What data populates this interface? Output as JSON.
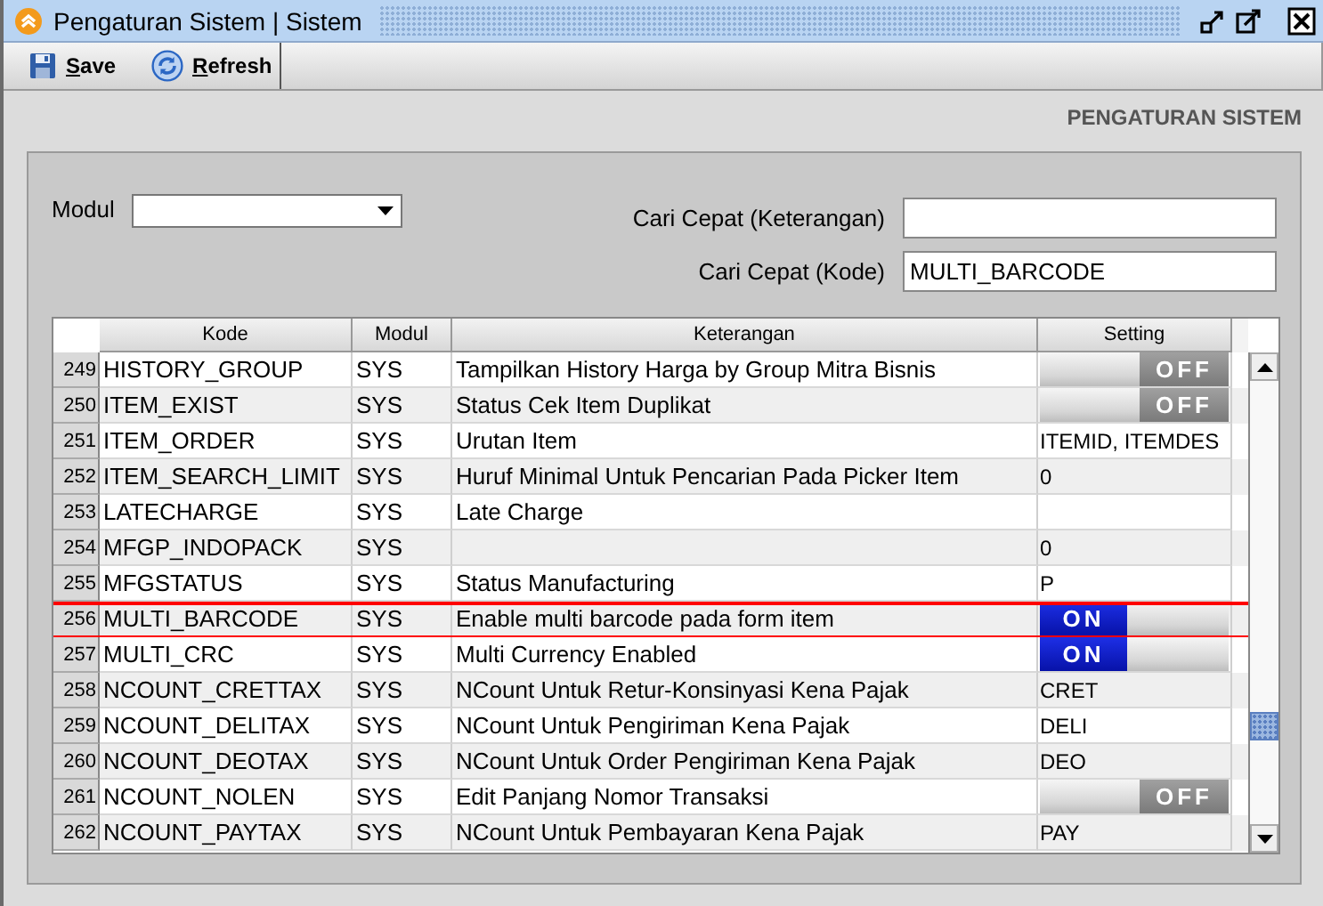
{
  "window": {
    "title": "Pengaturan Sistem | Sistem"
  },
  "toolbar": [
    {
      "label": "Save",
      "kind": "save"
    },
    {
      "label": "Refresh",
      "kind": "refresh"
    }
  ],
  "section_title": "PENGATURAN SISTEM",
  "filters": {
    "modul": {
      "label": "Modul"
    },
    "search_description": {
      "label": "Cari Cepat (Keterangan)"
    },
    "search_code": {
      "label": "Cari Cepat (Kode)",
      "value": "MULTI_BARCODE"
    }
  },
  "table": {
    "columns": [
      "Kode",
      "Modul",
      "Keterangan",
      "Setting"
    ],
    "rows": [
      {
        "no": "249",
        "kode": "HISTORY_GROUP",
        "modul": "SYS",
        "keterangan": "Tampilkan History Harga by Group Mitra Bisnis",
        "setting": {
          "kind": "toggle",
          "on": false,
          "label": "OFF"
        },
        "highlighted": false
      },
      {
        "no": "250",
        "kode": "ITEM_EXIST",
        "modul": "SYS",
        "keterangan": "Status Cek Item Duplikat",
        "setting": {
          "kind": "toggle",
          "on": false,
          "label": "OFF"
        },
        "highlighted": false
      },
      {
        "no": "251",
        "kode": "ITEM_ORDER",
        "modul": "SYS",
        "keterangan": "Urutan Item",
        "setting": {
          "kind": "text",
          "value": "ITEMID, ITEMDES"
        },
        "highlighted": false
      },
      {
        "no": "252",
        "kode": "ITEM_SEARCH_LIMIT",
        "modul": "SYS",
        "keterangan": "Huruf Minimal Untuk Pencarian Pada Picker Item",
        "setting": {
          "kind": "text",
          "value": "0"
        },
        "highlighted": false
      },
      {
        "no": "253",
        "kode": "LATECHARGE",
        "modul": "SYS",
        "keterangan": "Late Charge",
        "setting": {
          "kind": "text"
        },
        "highlighted": false
      },
      {
        "no": "254",
        "kode": "MFGP_INDOPACK",
        "modul": "SYS",
        "setting": {
          "kind": "text",
          "value": "0"
        },
        "highlighted": false
      },
      {
        "no": "255",
        "kode": "MFGSTATUS",
        "modul": "SYS",
        "keterangan": "Status Manufacturing",
        "setting": {
          "kind": "text",
          "value": "P"
        },
        "highlighted": false
      },
      {
        "no": "256",
        "kode": "MULTI_BARCODE",
        "modul": "SYS",
        "keterangan": "Enable multi barcode pada form item",
        "setting": {
          "kind": "toggle",
          "on": true,
          "label": "ON"
        },
        "highlighted": true
      },
      {
        "no": "257",
        "kode": "MULTI_CRC",
        "modul": "SYS",
        "keterangan": "Multi Currency Enabled",
        "setting": {
          "kind": "toggle",
          "on": true,
          "label": "ON"
        },
        "highlighted": false
      },
      {
        "no": "258",
        "kode": "NCOUNT_CRETTAX",
        "modul": "SYS",
        "keterangan": "NCount Untuk Retur-Konsinyasi Kena Pajak",
        "setting": {
          "kind": "text",
          "value": "CRET"
        },
        "highlighted": false
      },
      {
        "no": "259",
        "kode": "NCOUNT_DELITAX",
        "modul": "SYS",
        "keterangan": "NCount Untuk Pengiriman Kena Pajak",
        "setting": {
          "kind": "text",
          "value": "DELI"
        },
        "highlighted": false
      },
      {
        "no": "260",
        "kode": "NCOUNT_DEOTAX",
        "modul": "SYS",
        "keterangan": "NCount Untuk Order Pengiriman Kena Pajak",
        "setting": {
          "kind": "text",
          "value": "DEO"
        },
        "highlighted": false
      },
      {
        "no": "261",
        "kode": "NCOUNT_NOLEN",
        "modul": "SYS",
        "keterangan": "Edit Panjang Nomor Transaksi",
        "setting": {
          "kind": "toggle",
          "on": false,
          "label": "OFF"
        },
        "highlighted": false
      },
      {
        "no": "262",
        "kode": "NCOUNT_PAYTAX",
        "modul": "SYS",
        "keterangan": "NCount Untuk Pembayaran Kena Pajak",
        "setting": {
          "kind": "text",
          "value": "PAY"
        },
        "highlighted": false
      }
    ]
  }
}
